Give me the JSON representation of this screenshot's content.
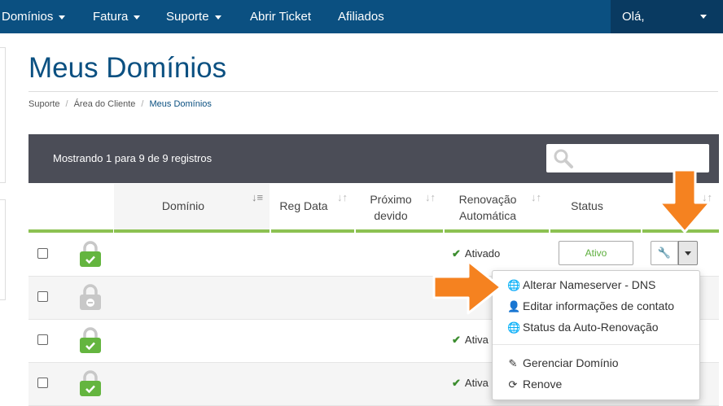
{
  "navbar": {
    "items": [
      {
        "label": "Domínios",
        "has_caret": true
      },
      {
        "label": "Fatura",
        "has_caret": true
      },
      {
        "label": "Suporte",
        "has_caret": true
      },
      {
        "label": "Abrir Ticket",
        "has_caret": false
      },
      {
        "label": "Afiliados",
        "has_caret": false
      }
    ],
    "user_greeting": "Olá,"
  },
  "page": {
    "title": "Meus Domínios"
  },
  "breadcrumb": [
    "Suporte",
    "Área do Cliente",
    "Meus Domínios"
  ],
  "table": {
    "info": "Mostrando 1 para 9 de 9 registros",
    "search_placeholder": "",
    "columns": [
      {
        "line1": "",
        "line2": "Domínio"
      },
      {
        "line1": "",
        "line2": "Reg Data"
      },
      {
        "line1": "Próximo",
        "line2": "devido"
      },
      {
        "line1": "Renovação",
        "line2": "Automática"
      },
      {
        "line1": "",
        "line2": "Status"
      }
    ],
    "rows": [
      {
        "lock": "green",
        "renewal": "Ativado",
        "status": "Ativo"
      },
      {
        "lock": "grey",
        "renewal": "",
        "status": ""
      },
      {
        "lock": "green",
        "renewal": "Ativa",
        "status": ""
      },
      {
        "lock": "green",
        "renewal": "Ativa",
        "status": ""
      }
    ]
  },
  "dropdown": {
    "items": [
      {
        "icon": "globe-icon",
        "label": "Alterar Nameserver - DNS"
      },
      {
        "icon": "user-icon",
        "label": "Editar informações de contato"
      },
      {
        "icon": "globe-icon",
        "label": "Status da Auto-Renovação"
      },
      {
        "icon": "pencil-icon",
        "label": "Gerenciar Domínio"
      },
      {
        "icon": "refresh-icon",
        "label": "Renove"
      }
    ]
  },
  "colors": {
    "navbar": "#0b5081",
    "user_menu": "#093a61",
    "title": "#0b5081",
    "header_bar": "#4b4d57",
    "column_underline": "#8cc152",
    "lock_green": "#64b53f",
    "lock_grey": "#c8c8c8",
    "annotation_arrow": "#f58220"
  }
}
